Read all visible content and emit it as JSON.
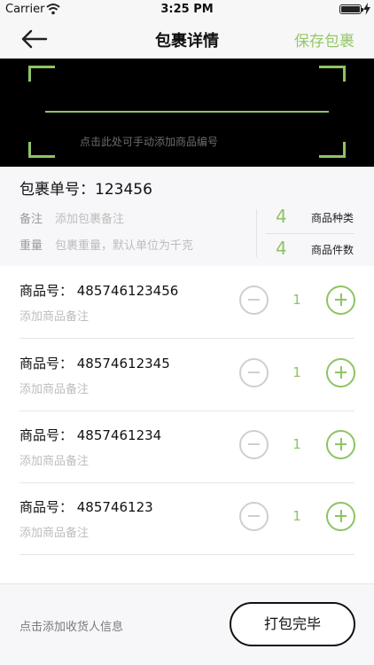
{
  "status_bar": {
    "carrier": "Carrier",
    "time": "3:25 PM"
  },
  "nav": {
    "title": "包裹详情",
    "save_label": "保存包裹"
  },
  "scanner": {
    "hint": "点击此处可手动添加商品编号"
  },
  "package": {
    "number_text": "包裹单号：123456",
    "remark_label": "备注",
    "remark_placeholder": "添加包裹备注",
    "weight_label": "重量",
    "weight_placeholder": "包裹重量，默认单位为千克",
    "stats": [
      {
        "value": "4",
        "label": "商品种类"
      },
      {
        "value": "4",
        "label": "商品件数"
      }
    ]
  },
  "items": [
    {
      "number_text": "商品号：  485746123456",
      "note_placeholder": "添加商品备注",
      "qty": "1"
    },
    {
      "number_text": "商品号：  48574612345",
      "note_placeholder": "添加商品备注",
      "qty": "1"
    },
    {
      "number_text": "商品号：  4857461234",
      "note_placeholder": "添加商品备注",
      "qty": "1"
    },
    {
      "number_text": "商品号：  485746123",
      "note_placeholder": "添加商品备注",
      "qty": "1"
    }
  ],
  "footer": {
    "add_receiver": "点击添加收货人信息",
    "finish_label": "打包完毕"
  },
  "colors": {
    "accent": "#8dc463",
    "save_text": "#94c86a",
    "placeholder": "#bdbdbd"
  }
}
